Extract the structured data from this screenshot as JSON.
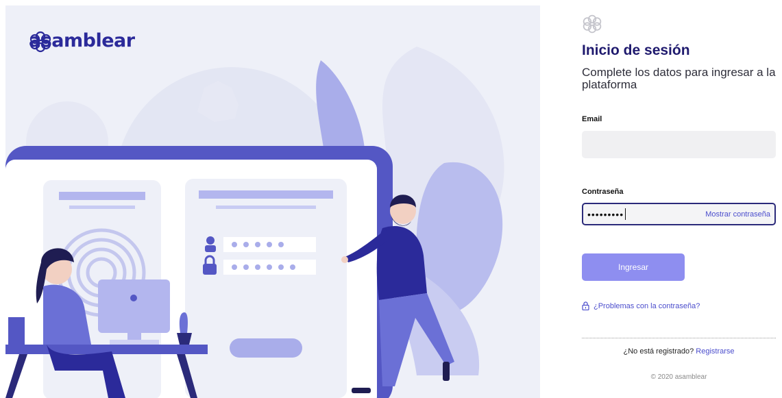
{
  "brand": {
    "name": "asamblear"
  },
  "login": {
    "title": "Inicio de sesión",
    "subtitle": "Complete los datos para ingresar a la plataforma",
    "email_label": "Email",
    "email_value": "",
    "password_label": "Contraseña",
    "password_masked": "•••••••••",
    "show_password": "Mostrar contraseña",
    "submit_label": "Ingresar",
    "trouble_link": "¿Problemas con la contraseña?",
    "register_prompt": "¿No está registrado?",
    "register_link": "Registrarse",
    "copyright": "© 2020 asamblear"
  },
  "icons": {
    "logo": "flower-logo-icon",
    "lock": "lock-icon"
  },
  "colors": {
    "brand": "#2b2a9a",
    "accent": "#8e8ef0",
    "link": "#4a4ccc",
    "hero_bg": "#eef0f8"
  }
}
